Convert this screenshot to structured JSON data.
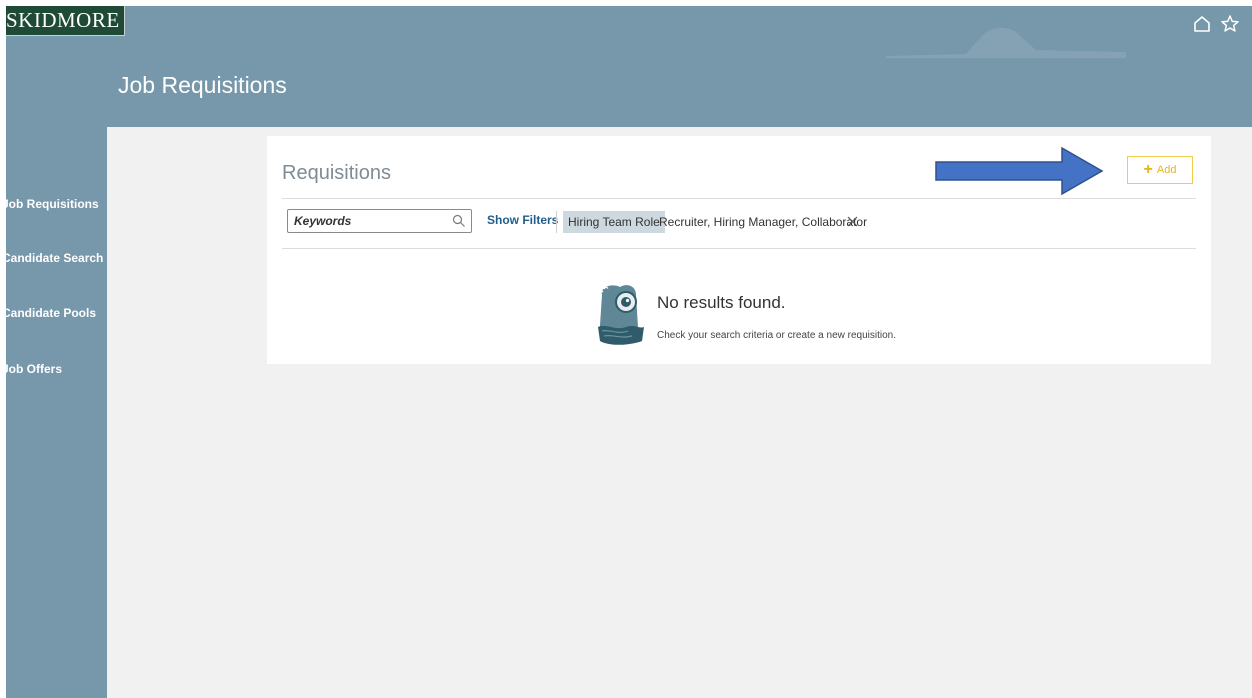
{
  "header": {
    "logo_text": "SKIDMORE",
    "page_title": "Job Requisitions",
    "icons": [
      "home-icon",
      "star-icon"
    ],
    "colors": {
      "banner": "#7797aa",
      "logo_bg": "#1e4a36"
    }
  },
  "sidebar": {
    "items": [
      {
        "label": "Job Requisitions"
      },
      {
        "label": "Candidate Search"
      },
      {
        "label": "Candidate Pools"
      },
      {
        "label": "Job Offers"
      }
    ]
  },
  "requisitions": {
    "title": "Requisitions",
    "add_label": "Add",
    "add_icon": "plus-icon",
    "accent": "#e6b41b"
  },
  "filters": {
    "keywords_placeholder": "Keywords",
    "show_filters_label": "Show Filters",
    "active_filter": {
      "label": "Hiring Team Role",
      "value": "Recruiter, Hiring Manager, Collaborator"
    }
  },
  "empty_state": {
    "title": "No results found.",
    "hint": "Check your search criteria or create a new requisition.",
    "icon": "binoculars-illustration-icon"
  },
  "annotation": {
    "icon": "right-arrow-icon",
    "color": "#4472c4"
  }
}
